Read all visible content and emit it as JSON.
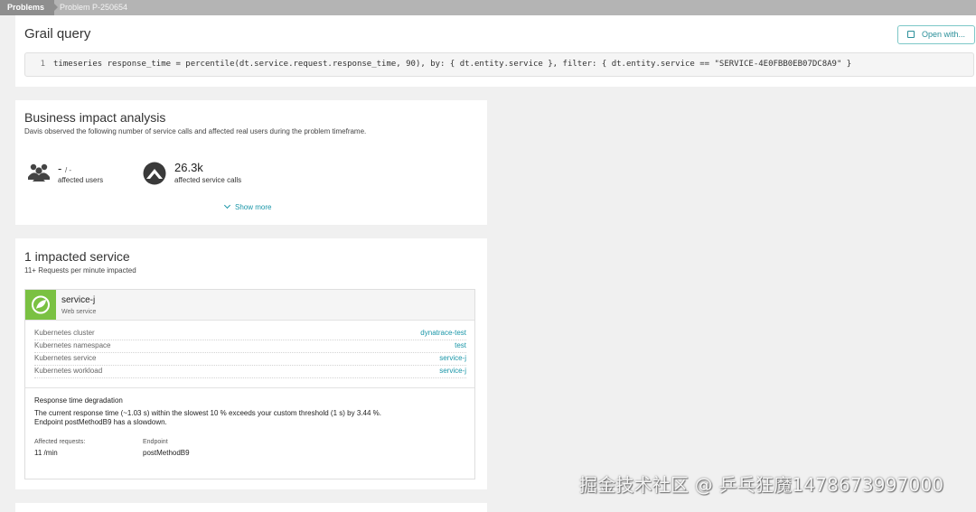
{
  "breadcrumb": {
    "items": [
      {
        "label": "Problems"
      },
      {
        "label": "Problem P-250654"
      }
    ]
  },
  "grail_query": {
    "title": "Grail query",
    "open_button_label": "Open with...",
    "line_number": "1",
    "query": "timeseries response_time = percentile(dt.service.request.response_time, 90), by: { dt.entity.service }, filter: { dt.entity.service == \"SERVICE-4E0FBB0EB07DC8A9\" }"
  },
  "business_impact": {
    "title": "Business impact analysis",
    "description": "Davis observed the following number of service calls and affected real users during the problem timeframe.",
    "users_value": "-",
    "users_sep": "/ -",
    "users_label": "affected users",
    "calls_value": "26.3k",
    "calls_label": "affected service calls",
    "show_more_label": "Show more"
  },
  "impacted": {
    "title": "1 impacted service",
    "subtitle": "11+ Requests per minute impacted",
    "service": {
      "name": "service-j",
      "type": "Web service",
      "properties": [
        {
          "key": "Kubernetes cluster",
          "value": "dynatrace-test"
        },
        {
          "key": "Kubernetes namespace",
          "value": "test"
        },
        {
          "key": "Kubernetes service",
          "value": "service-j"
        },
        {
          "key": "Kubernetes workload",
          "value": "service-j"
        }
      ],
      "degradation_title": "Response time degradation",
      "degradation_line1": "The current response time (~1.03 s) within the slowest 10 % exceeds your custom threshold (1 s) by 3.44 %.",
      "degradation_line2": "Endpoint postMethodB9 has a slowdown.",
      "affected_label": "Affected requests:",
      "affected_value": "11 /min",
      "endpoint_label": "Endpoint",
      "endpoint_value": "postMethodB9"
    }
  },
  "watermark": "掘金技术社区 @ 乒乓狂魔1478673997000",
  "colors": {
    "accent": "#1a96a8",
    "service_logo": "#7ac142",
    "topbar": "#b4b4b4"
  }
}
